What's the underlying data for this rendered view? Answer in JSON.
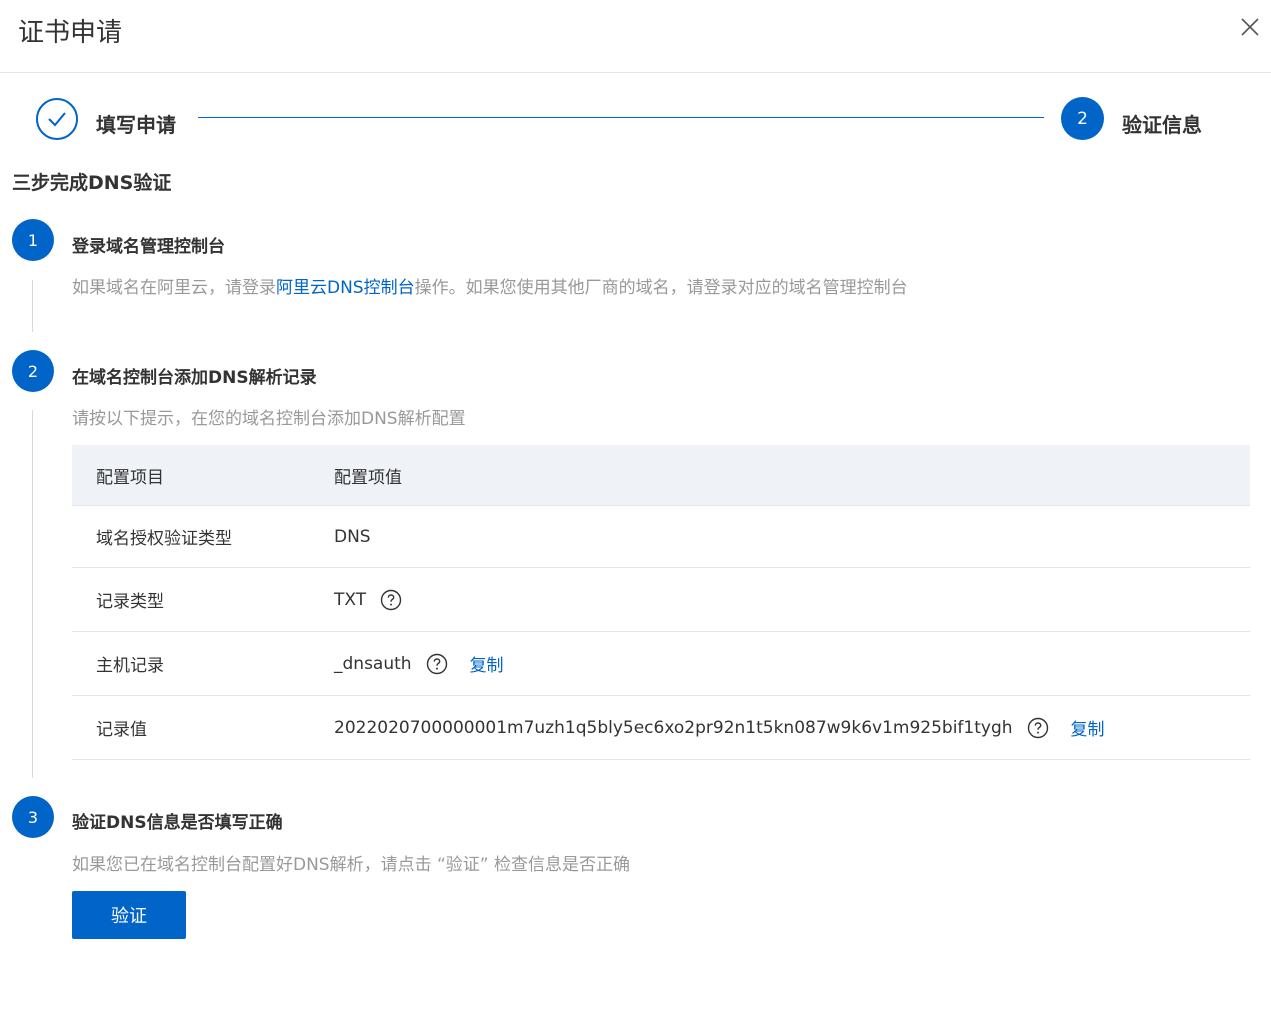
{
  "header": {
    "title": "证书申请"
  },
  "steps": [
    {
      "label": "填写申请",
      "status": "done"
    },
    {
      "number": "2",
      "label": "验证信息",
      "status": "active"
    }
  ],
  "section_title": "三步完成DNS验证",
  "items": [
    {
      "number": "1",
      "title": "登录域名管理控制台",
      "desc_pre": "如果域名在阿里云，请登录",
      "desc_link": "阿里云DNS控制台",
      "desc_post": "操作。如果您使用其他厂商的域名，请登录对应的域名管理控制台"
    },
    {
      "number": "2",
      "title": "在域名控制台添加DNS解析记录",
      "desc": "请按以下提示，在您的域名控制台添加DNS解析配置"
    },
    {
      "number": "3",
      "title": "验证DNS信息是否填写正确",
      "desc": "如果您已在域名控制台配置好DNS解析，请点击 “验证” 检查信息是否正确"
    }
  ],
  "table": {
    "headers": [
      "配置项目",
      "配置项值"
    ],
    "rows": [
      {
        "key": "域名授权验证类型",
        "value": "DNS"
      },
      {
        "key": "记录类型",
        "value": "TXT"
      },
      {
        "key": "主机记录",
        "value": "_dnsauth",
        "copy": "复制"
      },
      {
        "key": "记录值",
        "value": "2022020700000001m7uzh1q5bly5ec6xo2pr92n1t5kn087w9k6v1m925bif1tygh",
        "copy": "复制"
      }
    ]
  },
  "verify_button": "验证",
  "colors": {
    "primary": "#0064c8",
    "muted_text": "#999999",
    "table_header_bg": "#eff2f6"
  }
}
